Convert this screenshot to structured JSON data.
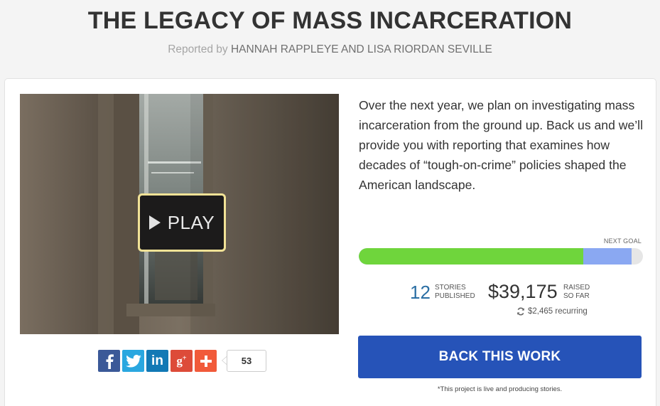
{
  "header": {
    "title": "THE LEGACY OF MASS INCARCERATION",
    "byline_prefix": "Reported by",
    "byline_authors": "HANNAH RAPPLEYE AND LISA RIORDAN SEVILLE"
  },
  "video": {
    "play_label": "PLAY"
  },
  "share": {
    "facebook_icon": "facebook-icon",
    "twitter_icon": "twitter-icon",
    "linkedin_icon": "linkedin-icon",
    "googleplus_icon": "google-plus-icon",
    "addthis_icon": "plus-icon",
    "count": "53",
    "colors": {
      "facebook": "#3b5998",
      "twitter": "#2aa7e0",
      "linkedin": "#1279b5",
      "googleplus": "#dd4b39",
      "addthis": "#f15a3a"
    }
  },
  "description": "Over the next year, we plan on investigating mass incarceration from the ground up. Back us and we’ll provide you with reporting that examines how decades of “tough-on-crime” policies shaped the American landscape.",
  "progress": {
    "next_goal_label": "NEXT GOAL",
    "funded_fraction": 0.79,
    "recurring_fraction": 0.96,
    "colors": {
      "funded": "#6fd53c",
      "recurring": "#8aa8f2",
      "track": "#e6e6e6"
    }
  },
  "stats": {
    "stories_count": "12",
    "stories_label_1": "STORIES",
    "stories_label_2": "PUBLISHED",
    "raised_amount": "$39,175",
    "raised_label_1": "RAISED",
    "raised_label_2": "SO FAR",
    "recurring_icon": "refresh-icon",
    "recurring_text": "$2,465 recurring"
  },
  "cta": {
    "back_label": "BACK THIS WORK",
    "accent": "#2653b8",
    "footnote": "*This project is live and producing stories."
  }
}
